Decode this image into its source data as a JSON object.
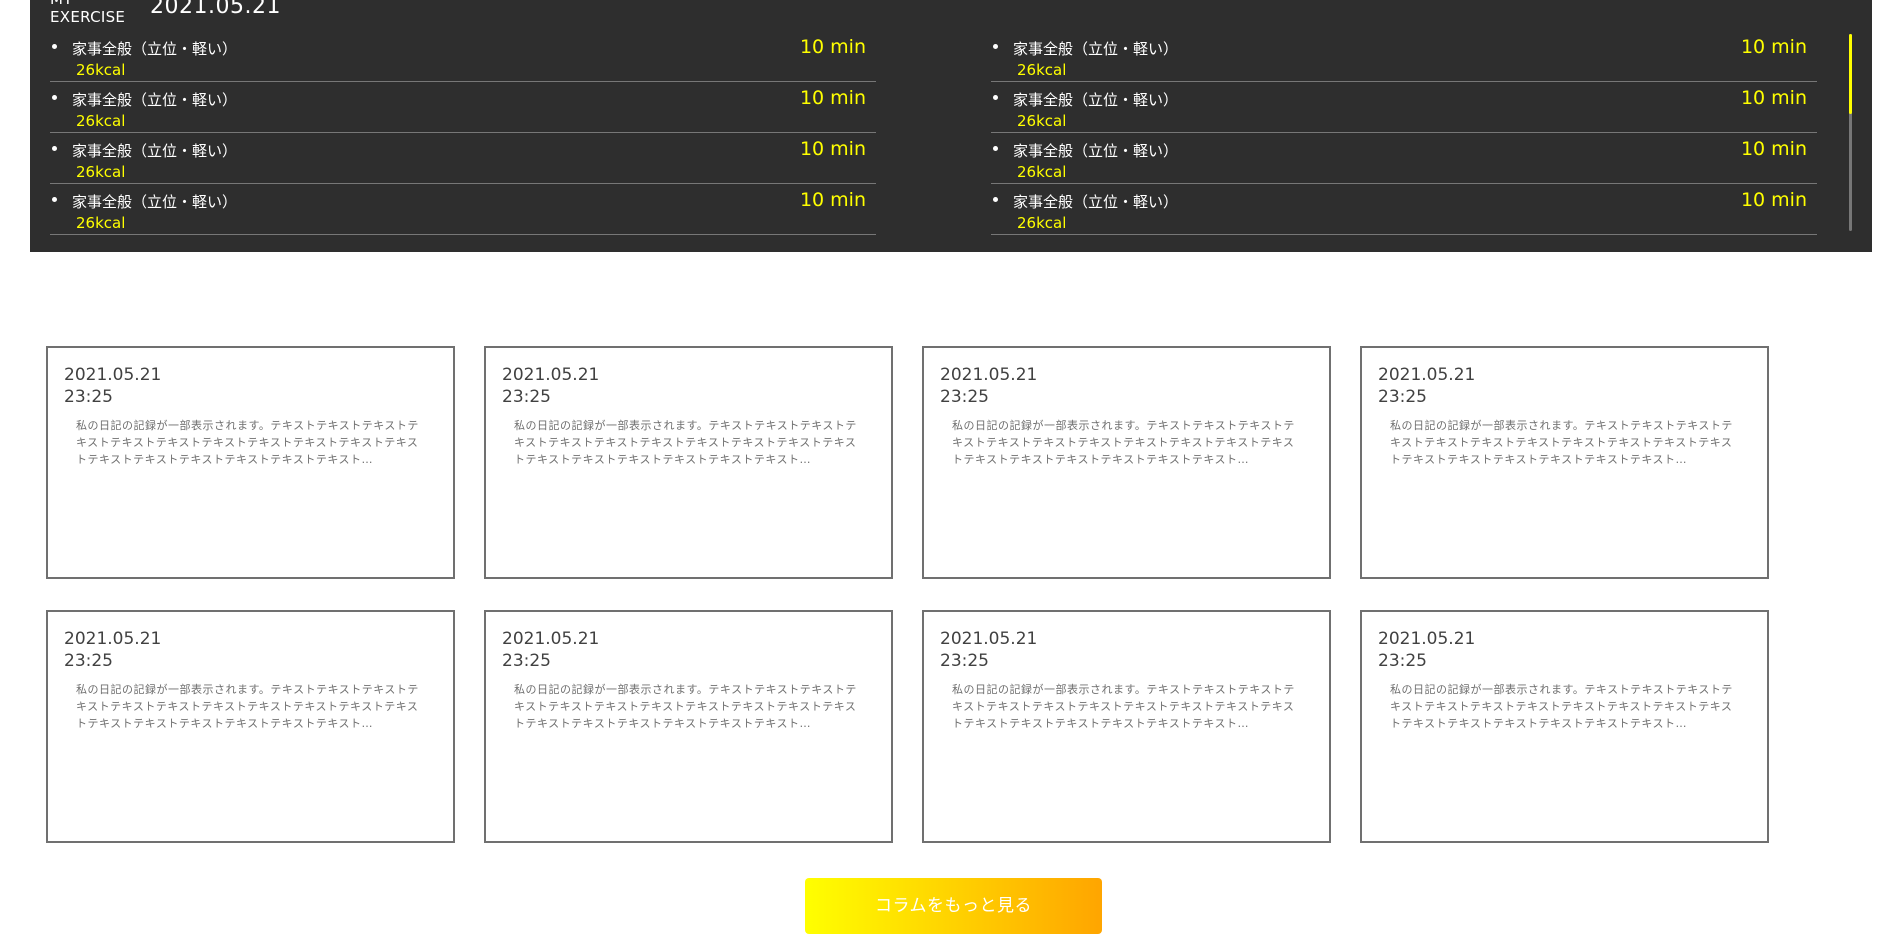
{
  "exercise": {
    "title_line1": "MY",
    "title_line2": "EXERCISE",
    "date": "2021.05.21",
    "colors": {
      "background": "#2e2e2e",
      "accent": "#ffff00",
      "text": "#ffffff"
    },
    "items_left": [
      {
        "name": "家事全般（立位・軽い）",
        "kcal": "26kcal",
        "duration": "10 min"
      },
      {
        "name": "家事全般（立位・軽い）",
        "kcal": "26kcal",
        "duration": "10 min"
      },
      {
        "name": "家事全般（立位・軽い）",
        "kcal": "26kcal",
        "duration": "10 min"
      },
      {
        "name": "家事全般（立位・軽い）",
        "kcal": "26kcal",
        "duration": "10 min"
      }
    ],
    "items_right": [
      {
        "name": "家事全般（立位・軽い）",
        "kcal": "26kcal",
        "duration": "10 min"
      },
      {
        "name": "家事全般（立位・軽い）",
        "kcal": "26kcal",
        "duration": "10 min"
      },
      {
        "name": "家事全般（立位・軽い）",
        "kcal": "26kcal",
        "duration": "10 min"
      },
      {
        "name": "家事全般（立位・軽い）",
        "kcal": "26kcal",
        "duration": "10 min"
      }
    ]
  },
  "diary": {
    "entries": [
      {
        "date": "2021.05.21",
        "time": "23:25",
        "text": "私の日記の記録が一部表示されます。テキストテキストテキストテキストテキストテキストテキストテキストテキストテキストテキストテキストテキストテキストテキストテキストテキスト…"
      },
      {
        "date": "2021.05.21",
        "time": "23:25",
        "text": "私の日記の記録が一部表示されます。テキストテキストテキストテキストテキストテキストテキストテキストテキストテキストテキストテキストテキストテキストテキストテキストテキスト…"
      },
      {
        "date": "2021.05.21",
        "time": "23:25",
        "text": "私の日記の記録が一部表示されます。テキストテキストテキストテキストテキストテキストテキストテキストテキストテキストテキストテキストテキストテキストテキストテキストテキスト…"
      },
      {
        "date": "2021.05.21",
        "time": "23:25",
        "text": "私の日記の記録が一部表示されます。テキストテキストテキストテキストテキストテキストテキストテキストテキストテキストテキストテキストテキストテキストテキストテキストテキスト…"
      },
      {
        "date": "2021.05.21",
        "time": "23:25",
        "text": "私の日記の記録が一部表示されます。テキストテキストテキストテキストテキストテキストテキストテキストテキストテキストテキストテキストテキストテキストテキストテキストテキスト…"
      },
      {
        "date": "2021.05.21",
        "time": "23:25",
        "text": "私の日記の記録が一部表示されます。テキストテキストテキストテキストテキストテキストテキストテキストテキストテキストテキストテキストテキストテキストテキストテキストテキスト…"
      },
      {
        "date": "2021.05.21",
        "time": "23:25",
        "text": "私の日記の記録が一部表示されます。テキストテキストテキストテキストテキストテキストテキストテキストテキストテキストテキストテキストテキストテキストテキストテキストテキスト…"
      },
      {
        "date": "2021.05.21",
        "time": "23:25",
        "text": "私の日記の記録が一部表示されます。テキストテキストテキストテキストテキストテキストテキストテキストテキストテキストテキストテキストテキストテキストテキストテキストテキスト…"
      }
    ],
    "more_button_label": "コラムをもっと見る",
    "button_gradient": [
      "#ffff00",
      "#ffa500"
    ]
  }
}
